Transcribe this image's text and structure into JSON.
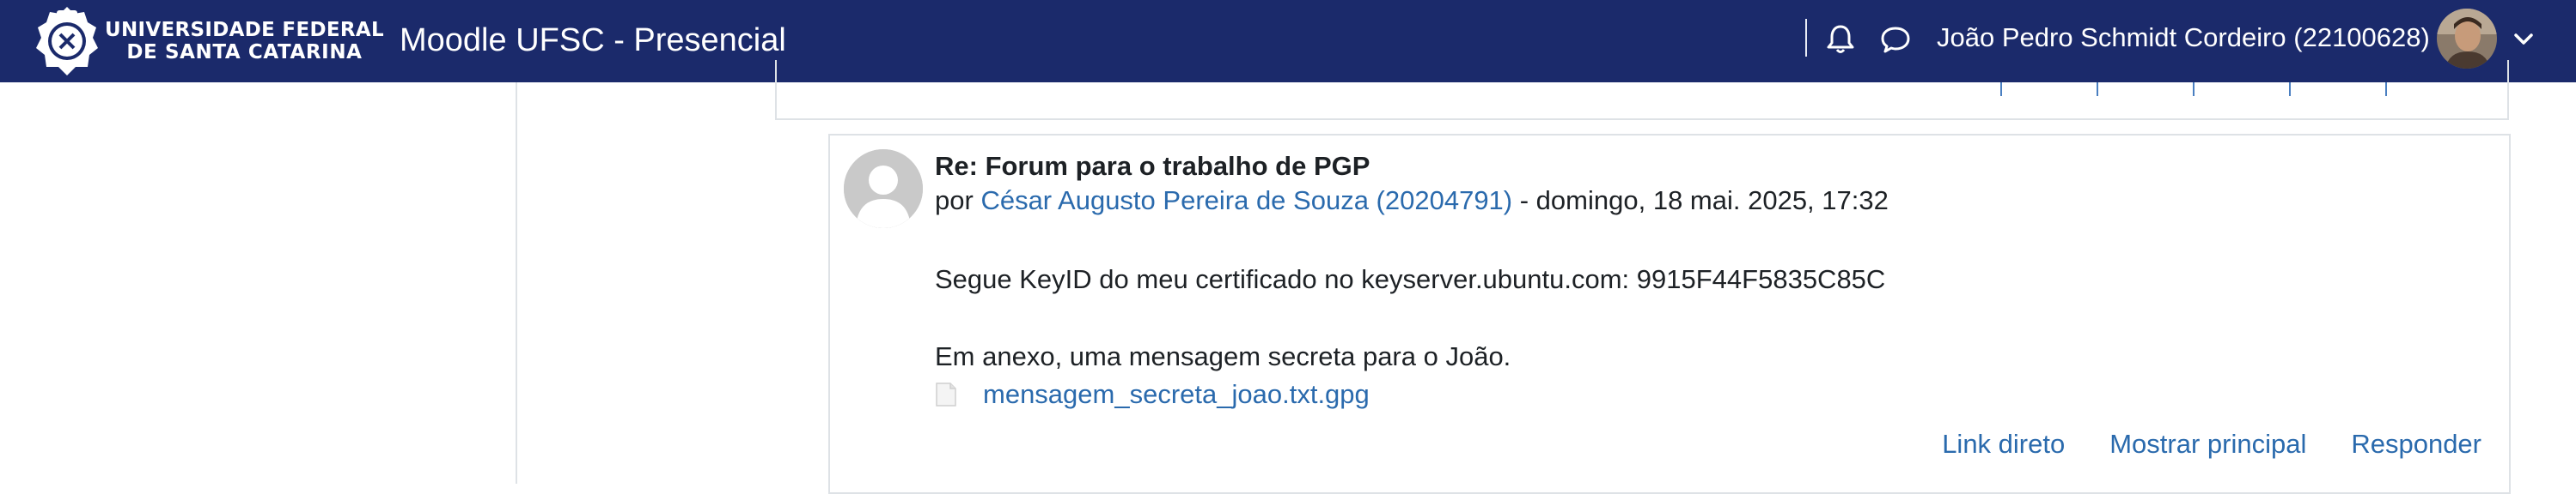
{
  "header": {
    "university_line1": "UNIVERSIDADE FEDERAL",
    "university_line2": "DE SANTA CATARINA",
    "site_title": "Moodle UFSC - Presencial",
    "user_name": "João Pedro Schmidt Cordeiro (22100628)",
    "icons": [
      "ufsc-seal-logo",
      "bell-icon",
      "chat-icon",
      "chevron-down-icon"
    ]
  },
  "post": {
    "subject": "Re: Forum para o trabalho de PGP",
    "by_prefix": "por",
    "author": "César Augusto Pereira de Souza (20204791)",
    "date": "- domingo, 18 mai. 2025, 17:32",
    "message_line1": "Segue KeyID do meu certificado no keyserver.ubuntu.com: 9915F44F5835C85C",
    "message_line2": "Em anexo, uma mensagem secreta para o João.",
    "attachment_name": "mensagem_secreta_joao.txt.gpg",
    "actions": {
      "permalink": "Link direto",
      "show_parent": "Mostrar principal",
      "reply": "Responder"
    }
  },
  "colors": {
    "navbar_bg": "#1b2a6b",
    "link": "#2a6aad",
    "border": "#dee2e6"
  }
}
